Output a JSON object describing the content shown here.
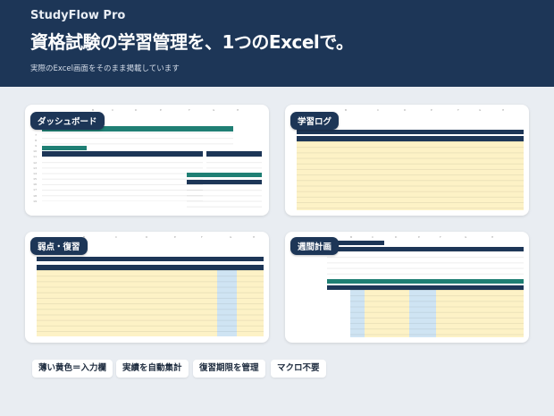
{
  "header": {
    "brand": "StudyFlow Pro",
    "headline": "資格試験の学習管理を、1つのExcelで。",
    "subline": "実際のExcel画面をそのまま掲載しています"
  },
  "cards": [
    {
      "tag": "ダッシュボード"
    },
    {
      "tag": "学習ログ"
    },
    {
      "tag": "弱点・復習"
    },
    {
      "tag": "週間計画"
    }
  ],
  "chips": [
    "薄い黄色＝入力欄",
    "実績を自動集計",
    "復習期限を管理",
    "マクロ不要"
  ],
  "colors": {
    "header_bg": "#1d3657",
    "page_bg": "#e9edf2",
    "input_yellow": "#fdf2c6",
    "accent_teal": "#1f7f74",
    "accent_blue": "#cfe4f3"
  }
}
